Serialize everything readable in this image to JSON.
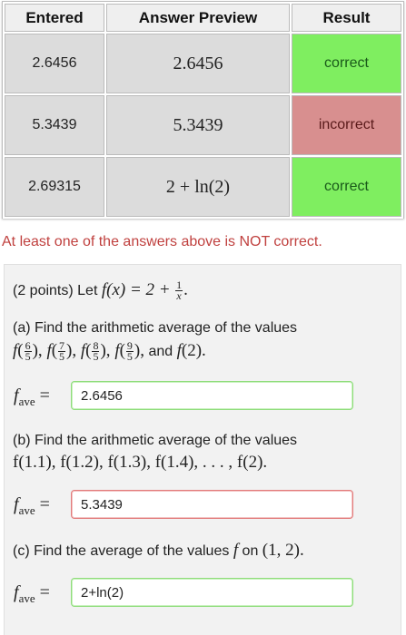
{
  "results_table": {
    "headers": [
      "Entered",
      "Answer Preview",
      "Result"
    ],
    "rows": [
      {
        "entered": "2.6456",
        "preview": "2.6456",
        "result": "correct"
      },
      {
        "entered": "5.3439",
        "preview": "5.3439",
        "result": "incorrect"
      },
      {
        "entered": "2.69315",
        "preview": "2 + ln(2)",
        "result": "correct"
      }
    ]
  },
  "alert_message": "At least one of the answers above is NOT correct.",
  "problem": {
    "points_label": "(2 points) Let",
    "function_def": "f(x) = 2 +",
    "part_a": {
      "prompt": "(a) Find the arithmetic average of the values",
      "values_text": "f(6/5), f(7/5), f(8/5), f(9/5), and f(2).",
      "and_word": "and",
      "answer": "2.6456"
    },
    "part_b": {
      "prompt": "(b) Find the arithmetic average of the values",
      "values_text": "f(1.1), f(1.2), f(1.3), f(1.4), . . . , f(2).",
      "answer": "5.3439"
    },
    "part_c": {
      "prompt": "(c) Find the average of the values",
      "f_symbol": "f",
      "on_word": "on",
      "interval": "(1, 2).",
      "answer": "2+ln(2)"
    },
    "fave_label": "f",
    "fave_sub": "ave",
    "equals": "="
  },
  "colors": {
    "correct": "#7fee60",
    "incorrect": "#d88f8f",
    "alert_text": "#c0413f"
  }
}
